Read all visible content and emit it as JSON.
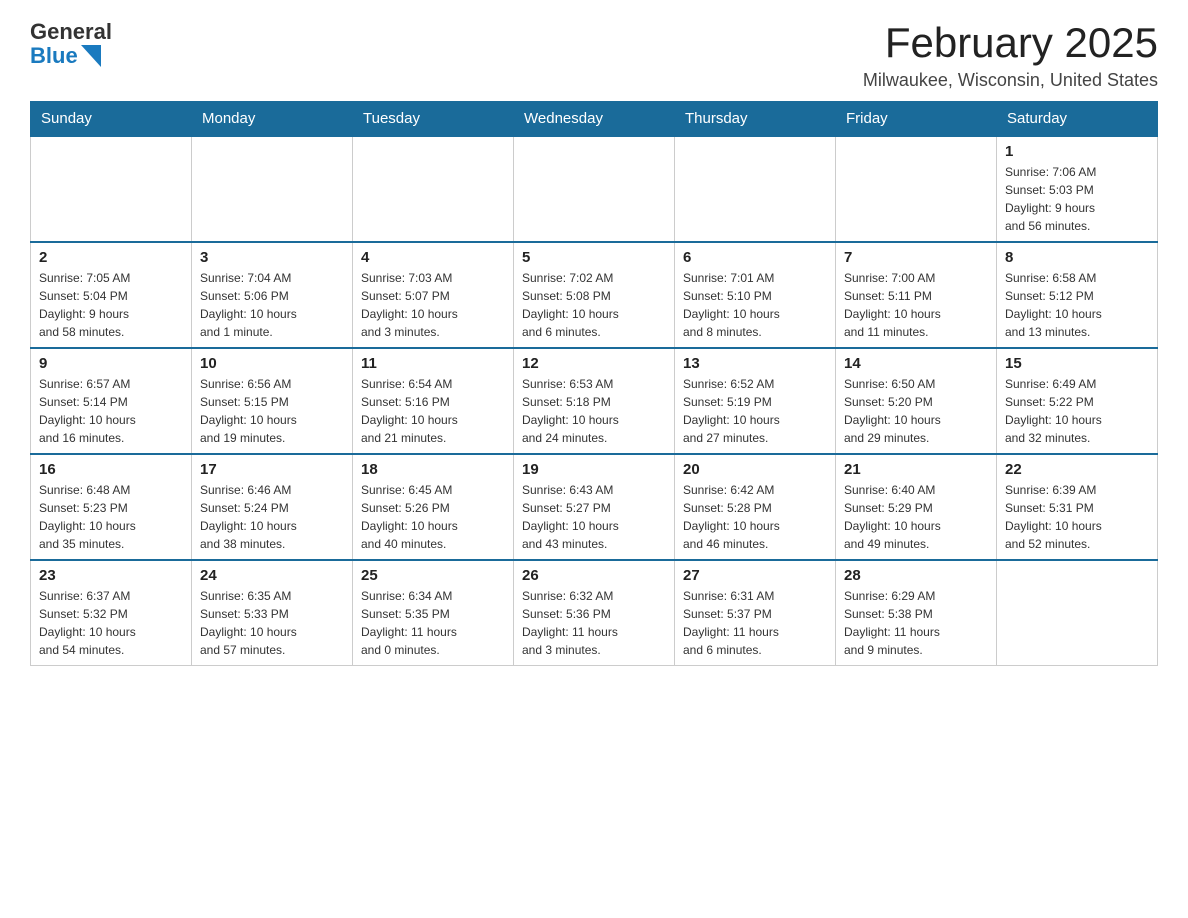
{
  "header": {
    "logo_general": "General",
    "logo_blue": "Blue",
    "title": "February 2025",
    "location": "Milwaukee, Wisconsin, United States"
  },
  "days_of_week": [
    "Sunday",
    "Monday",
    "Tuesday",
    "Wednesday",
    "Thursday",
    "Friday",
    "Saturday"
  ],
  "weeks": [
    [
      {
        "day": "",
        "info": ""
      },
      {
        "day": "",
        "info": ""
      },
      {
        "day": "",
        "info": ""
      },
      {
        "day": "",
        "info": ""
      },
      {
        "day": "",
        "info": ""
      },
      {
        "day": "",
        "info": ""
      },
      {
        "day": "1",
        "info": "Sunrise: 7:06 AM\nSunset: 5:03 PM\nDaylight: 9 hours\nand 56 minutes."
      }
    ],
    [
      {
        "day": "2",
        "info": "Sunrise: 7:05 AM\nSunset: 5:04 PM\nDaylight: 9 hours\nand 58 minutes."
      },
      {
        "day": "3",
        "info": "Sunrise: 7:04 AM\nSunset: 5:06 PM\nDaylight: 10 hours\nand 1 minute."
      },
      {
        "day": "4",
        "info": "Sunrise: 7:03 AM\nSunset: 5:07 PM\nDaylight: 10 hours\nand 3 minutes."
      },
      {
        "day": "5",
        "info": "Sunrise: 7:02 AM\nSunset: 5:08 PM\nDaylight: 10 hours\nand 6 minutes."
      },
      {
        "day": "6",
        "info": "Sunrise: 7:01 AM\nSunset: 5:10 PM\nDaylight: 10 hours\nand 8 minutes."
      },
      {
        "day": "7",
        "info": "Sunrise: 7:00 AM\nSunset: 5:11 PM\nDaylight: 10 hours\nand 11 minutes."
      },
      {
        "day": "8",
        "info": "Sunrise: 6:58 AM\nSunset: 5:12 PM\nDaylight: 10 hours\nand 13 minutes."
      }
    ],
    [
      {
        "day": "9",
        "info": "Sunrise: 6:57 AM\nSunset: 5:14 PM\nDaylight: 10 hours\nand 16 minutes."
      },
      {
        "day": "10",
        "info": "Sunrise: 6:56 AM\nSunset: 5:15 PM\nDaylight: 10 hours\nand 19 minutes."
      },
      {
        "day": "11",
        "info": "Sunrise: 6:54 AM\nSunset: 5:16 PM\nDaylight: 10 hours\nand 21 minutes."
      },
      {
        "day": "12",
        "info": "Sunrise: 6:53 AM\nSunset: 5:18 PM\nDaylight: 10 hours\nand 24 minutes."
      },
      {
        "day": "13",
        "info": "Sunrise: 6:52 AM\nSunset: 5:19 PM\nDaylight: 10 hours\nand 27 minutes."
      },
      {
        "day": "14",
        "info": "Sunrise: 6:50 AM\nSunset: 5:20 PM\nDaylight: 10 hours\nand 29 minutes."
      },
      {
        "day": "15",
        "info": "Sunrise: 6:49 AM\nSunset: 5:22 PM\nDaylight: 10 hours\nand 32 minutes."
      }
    ],
    [
      {
        "day": "16",
        "info": "Sunrise: 6:48 AM\nSunset: 5:23 PM\nDaylight: 10 hours\nand 35 minutes."
      },
      {
        "day": "17",
        "info": "Sunrise: 6:46 AM\nSunset: 5:24 PM\nDaylight: 10 hours\nand 38 minutes."
      },
      {
        "day": "18",
        "info": "Sunrise: 6:45 AM\nSunset: 5:26 PM\nDaylight: 10 hours\nand 40 minutes."
      },
      {
        "day": "19",
        "info": "Sunrise: 6:43 AM\nSunset: 5:27 PM\nDaylight: 10 hours\nand 43 minutes."
      },
      {
        "day": "20",
        "info": "Sunrise: 6:42 AM\nSunset: 5:28 PM\nDaylight: 10 hours\nand 46 minutes."
      },
      {
        "day": "21",
        "info": "Sunrise: 6:40 AM\nSunset: 5:29 PM\nDaylight: 10 hours\nand 49 minutes."
      },
      {
        "day": "22",
        "info": "Sunrise: 6:39 AM\nSunset: 5:31 PM\nDaylight: 10 hours\nand 52 minutes."
      }
    ],
    [
      {
        "day": "23",
        "info": "Sunrise: 6:37 AM\nSunset: 5:32 PM\nDaylight: 10 hours\nand 54 minutes."
      },
      {
        "day": "24",
        "info": "Sunrise: 6:35 AM\nSunset: 5:33 PM\nDaylight: 10 hours\nand 57 minutes."
      },
      {
        "day": "25",
        "info": "Sunrise: 6:34 AM\nSunset: 5:35 PM\nDaylight: 11 hours\nand 0 minutes."
      },
      {
        "day": "26",
        "info": "Sunrise: 6:32 AM\nSunset: 5:36 PM\nDaylight: 11 hours\nand 3 minutes."
      },
      {
        "day": "27",
        "info": "Sunrise: 6:31 AM\nSunset: 5:37 PM\nDaylight: 11 hours\nand 6 minutes."
      },
      {
        "day": "28",
        "info": "Sunrise: 6:29 AM\nSunset: 5:38 PM\nDaylight: 11 hours\nand 9 minutes."
      },
      {
        "day": "",
        "info": ""
      }
    ]
  ]
}
